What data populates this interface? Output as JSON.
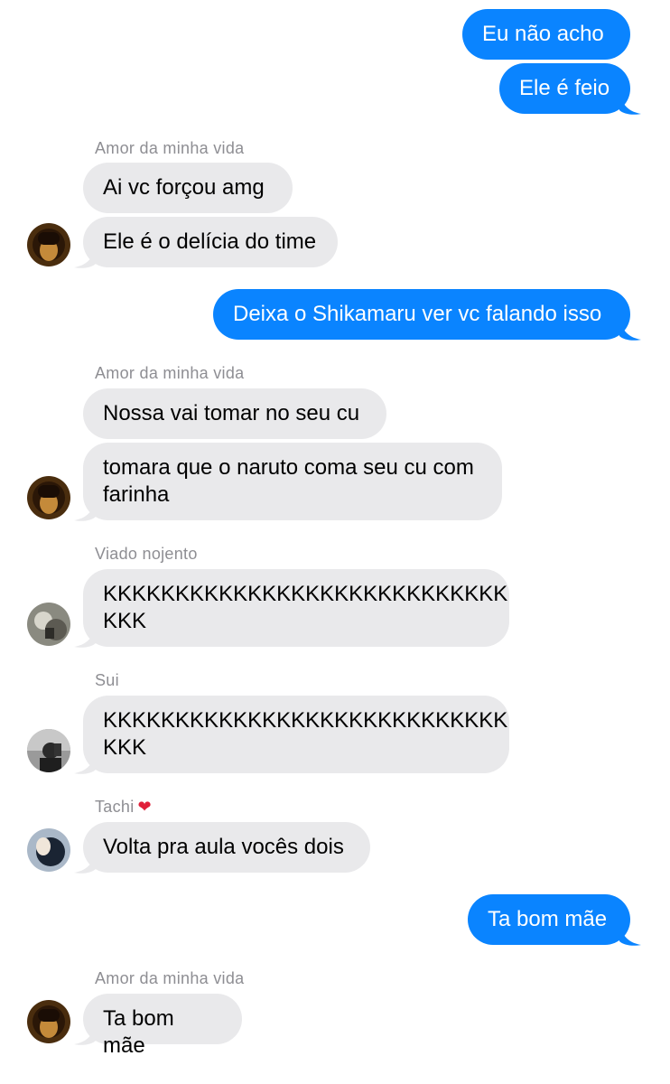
{
  "messages": [
    {
      "text": "Eu não acho"
    },
    {
      "text": "Ele é feio"
    },
    {
      "sender": "Amor da minha vida"
    },
    {
      "text": "Ai vc forçou amg"
    },
    {
      "text": "Ele é o delícia do time"
    },
    {
      "text": "Deixa o Shikamaru ver vc falando isso"
    },
    {
      "sender": "Amor da minha vida"
    },
    {
      "text": "Nossa vai tomar no seu cu"
    },
    {
      "text": "tomara que o naruto coma seu cu com\nfarinha"
    },
    {
      "sender": "Viado nojento"
    },
    {
      "text": "KKKKKKKKKKKKKKKKKKKKKKKKKKKK\nKKK"
    },
    {
      "sender": "Sui"
    },
    {
      "text": "KKKKKKKKKKKKKKKKKKKKKKKKKKKK\nKKK"
    },
    {
      "sender": "Tachi",
      "emoji": "❤"
    },
    {
      "text": "Volta pra aula vocês dois"
    },
    {
      "text": "Ta bom mãe"
    },
    {
      "sender": "Amor da minha vida"
    },
    {
      "text": "Ta bom mãe"
    }
  ]
}
